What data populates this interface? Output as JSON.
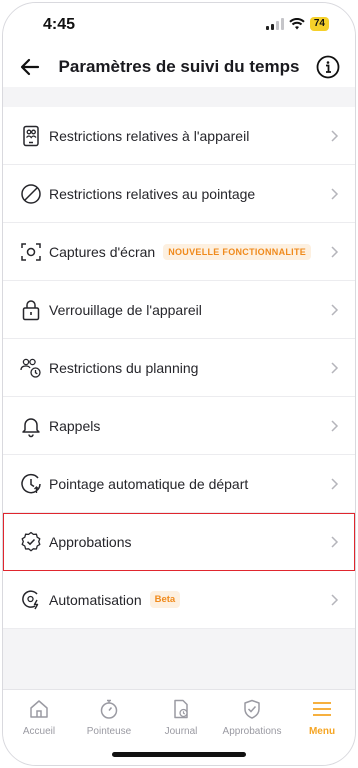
{
  "status": {
    "time": "4:45",
    "battery": "74"
  },
  "header": {
    "title": "Paramètres de suivi du temps"
  },
  "items": [
    {
      "label": "Restrictions relatives à l'appareil",
      "icon": "device-restrictions-icon"
    },
    {
      "label": "Restrictions relatives au pointage",
      "icon": "prohibited-icon"
    },
    {
      "label": "Captures d'écran",
      "badge": "NOUVELLE FONCTIONNALITE",
      "icon": "screenshot-icon"
    },
    {
      "label": "Verrouillage de l'appareil",
      "icon": "lock-icon"
    },
    {
      "label": "Restrictions du planning",
      "icon": "people-clock-icon"
    },
    {
      "label": "Rappels",
      "icon": "bell-icon"
    },
    {
      "label": "Pointage automatique de départ",
      "icon": "clock-auto-icon"
    },
    {
      "label": "Approbations",
      "icon": "badge-check-icon",
      "highlighted": true
    },
    {
      "label": "Automatisation",
      "badge": "Beta",
      "icon": "automation-icon"
    }
  ],
  "tabs": [
    {
      "label": "Accueil",
      "icon": "home-icon"
    },
    {
      "label": "Pointeuse",
      "icon": "stopwatch-icon"
    },
    {
      "label": "Journal",
      "icon": "journal-icon"
    },
    {
      "label": "Approbations",
      "icon": "shield-check-icon"
    },
    {
      "label": "Menu",
      "icon": "menu-icon",
      "active": true
    }
  ],
  "colors": {
    "accent": "#f5a524",
    "badge_text": "#f08a1c",
    "highlight": "#e0262e"
  }
}
